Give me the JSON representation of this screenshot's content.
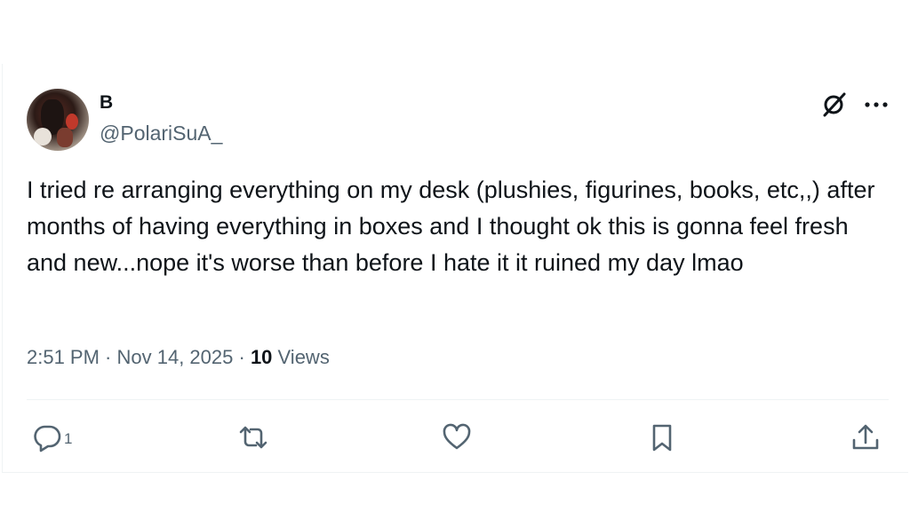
{
  "user": {
    "display_name": "B",
    "handle": "@PolariSuA_"
  },
  "tweet": {
    "text": "I tried re arranging everything on my desk (plushies, figurines, books, etc,,) after months of having everything in boxes and I thought ok this is gonna feel fresh and new...nope it's worse than before I hate it it ruined my day lmao",
    "time": "2:51 PM",
    "separator": " · ",
    "date": "Nov 14, 2025",
    "views_count": "10",
    "views_label": " Views"
  },
  "actions": {
    "reply_count": "1"
  },
  "icons": {
    "grok": "grok-icon",
    "more": "more-icon",
    "reply": "reply-icon",
    "retweet": "retweet-icon",
    "like": "heart-icon",
    "bookmark": "bookmark-icon",
    "share": "share-icon"
  },
  "colors": {
    "text_primary": "#0f1419",
    "text_secondary": "#536471",
    "border": "#eff3f4"
  }
}
